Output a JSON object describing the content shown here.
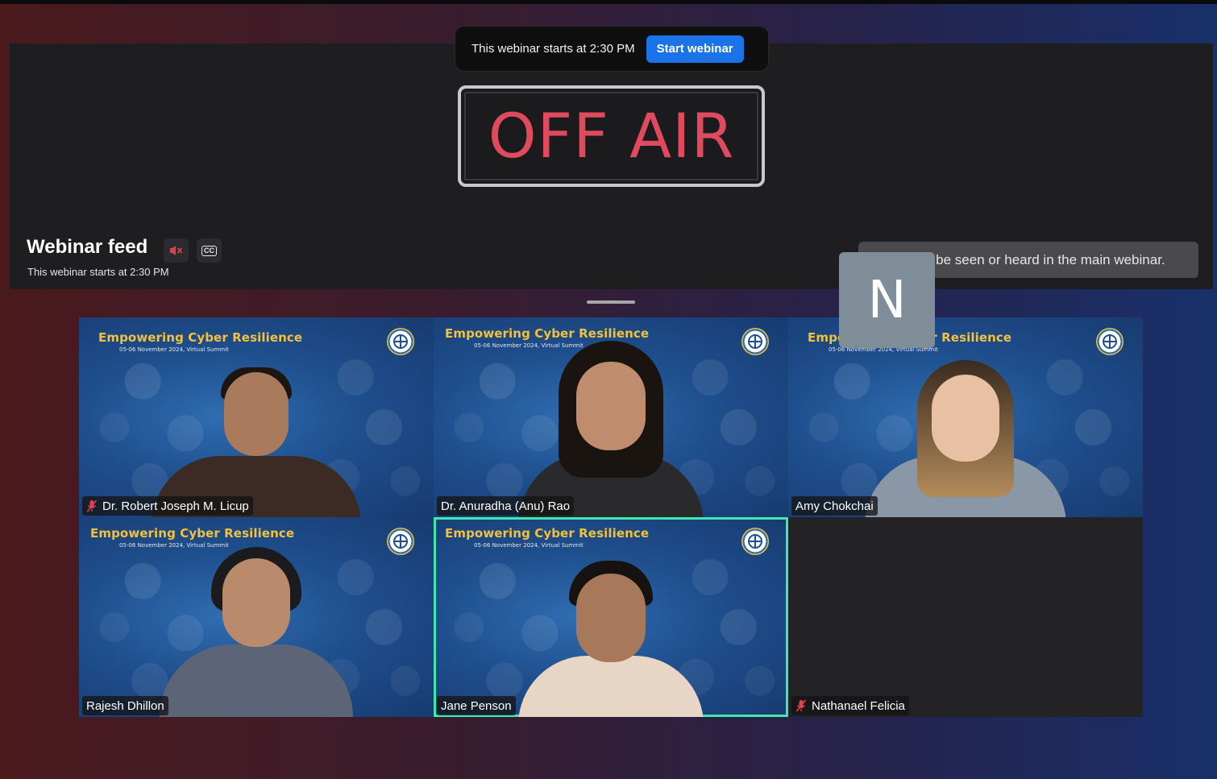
{
  "stage": {
    "notice_text": "This webinar starts at 2:30 PM",
    "start_button": "Start webinar",
    "off_air_sign": "OFF AIR"
  },
  "feed": {
    "title": "Webinar feed",
    "subtitle": "This webinar starts at 2:30 PM",
    "muted_icon": "speaker-muted-icon",
    "cc_icon": "closed-captions-icon",
    "warning": "You cannot be seen or heard in the main webinar."
  },
  "banner": {
    "title": "Empowering Cyber Resilience",
    "subtitle": "05-06 November 2024, Virtual Summit"
  },
  "participants": [
    {
      "name": "Dr. Robert Joseph M. Licup",
      "mic_muted": true
    },
    {
      "name": "Dr. Anuradha (Anu) Rao",
      "mic_muted": false
    },
    {
      "name": "Amy Chokchai",
      "mic_muted": false
    },
    {
      "name": "Rajesh Dhillon",
      "mic_muted": false
    },
    {
      "name": "Jane Penson",
      "mic_muted": false,
      "active_speaker": true
    },
    {
      "name": "Nathanael Felicia",
      "mic_muted": true,
      "video_off": true,
      "avatar_initial": "N"
    }
  ],
  "colors": {
    "accent_blue": "#1a73e8",
    "off_air_red": "#e04a5f",
    "active_speaker_outline": "#3ee8b0",
    "banner_gold": "#f3c13a",
    "mute_red": "#e0424e"
  }
}
